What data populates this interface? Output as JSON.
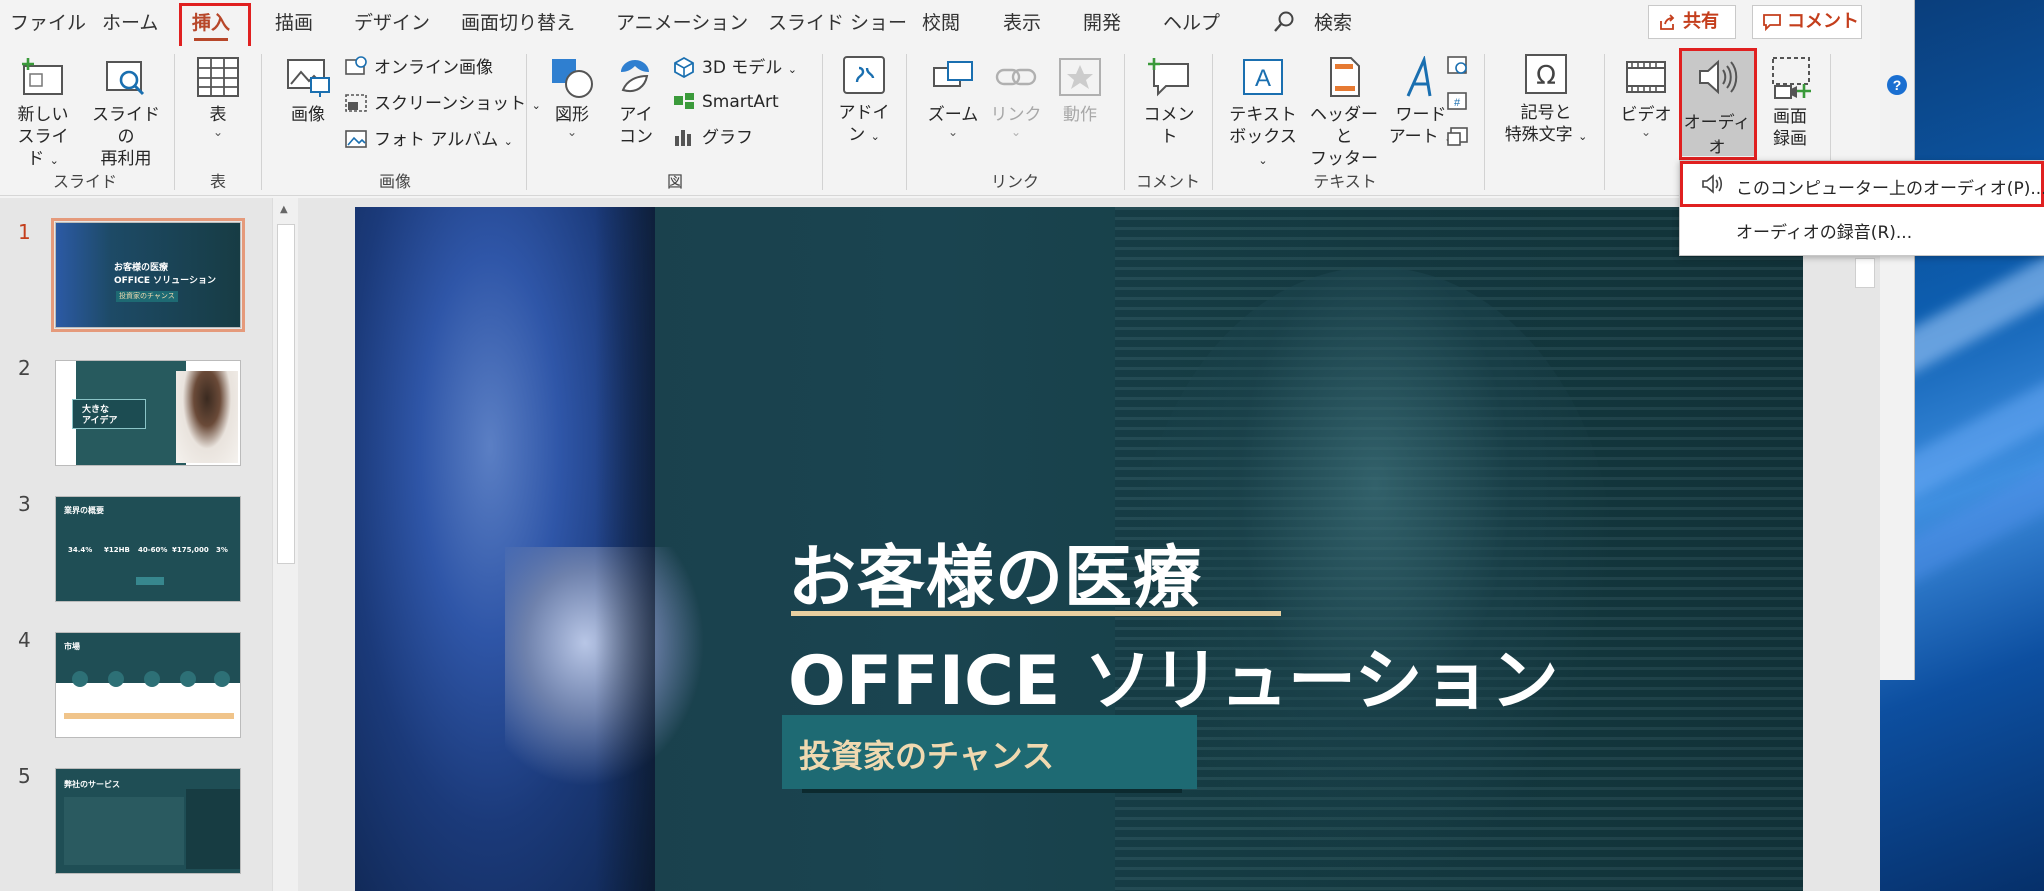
{
  "tabs": [
    "ファイル",
    "ホーム",
    "挿入",
    "描画",
    "デザイン",
    "画面切り替え",
    "アニメーション",
    "スライド ショー",
    "校閲",
    "表示",
    "開発",
    "ヘルプ"
  ],
  "active_tab": "挿入",
  "search_label": "検索",
  "share_label": "共有",
  "comment_label": "コメント",
  "ribbon": {
    "new_slide_1": "新しい",
    "new_slide_2": "スライド",
    "reuse_1": "スライドの",
    "reuse_2": "再利用",
    "group_slides": "スライド",
    "table": "表",
    "group_table": "表",
    "picture": "画像",
    "online_pictures": "オンライン画像",
    "screenshot": "スクリーンショット",
    "photo_album": "フォト アルバム",
    "group_images": "画像",
    "shapes": "図形",
    "icons_1": "アイ",
    "icons_2": "コン",
    "models_3d": "3D モデル",
    "smartart": "SmartArt",
    "chart": "グラフ",
    "group_illustrations": "図",
    "addins_1": "アドイ",
    "addins_2": "ン",
    "zoom": "ズーム",
    "link": "リンク",
    "action": "動作",
    "group_links": "リンク",
    "comment": "コメント",
    "group_comments": "コメント",
    "textbox_1": "テキスト",
    "textbox_2": "ボックス",
    "headerfooter_1": "ヘッダーと",
    "headerfooter_2": "フッター",
    "wordart_1": "ワード",
    "wordart_2": "アート",
    "group_text": "テキスト",
    "symbols_1": "記号と",
    "symbols_2": "特殊文字",
    "video": "ビデオ",
    "audio": "オーディオ",
    "screen_rec_1": "画面",
    "screen_rec_2": "録画"
  },
  "audio_menu": {
    "item1": "このコンピューター上のオーディオ(P)...",
    "item2": "オーディオの録音(R)..."
  },
  "thumbnails": [
    {
      "num": "1",
      "title1": "お客様の医療",
      "title2": "OFFICE ソリューション",
      "sub": "投資家のチャンス"
    },
    {
      "num": "2",
      "title1": "大きな",
      "title2": "アイデア"
    },
    {
      "num": "3",
      "title1": "業界の概要",
      "v1": "34.4%",
      "v2": "¥12HB",
      "v3": "40-60%",
      "v4": "¥175,000",
      "v5": "3%"
    },
    {
      "num": "4",
      "title1": "市場"
    },
    {
      "num": "5",
      "title1": "弊社のサービス"
    }
  ],
  "slide": {
    "title1": "お客様の医療",
    "title2": "OFFICE ソリューション",
    "subtitle": "投資家のチャンス"
  },
  "colors": {
    "accent": "#b7472a",
    "highlight": "#e02020",
    "subtitle_box": "#1e6a73",
    "rule": "#e8cfa0"
  }
}
